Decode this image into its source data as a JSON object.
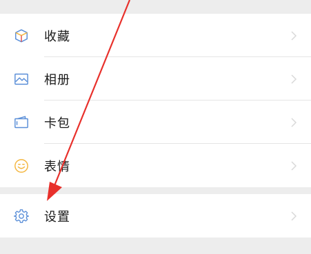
{
  "menu": {
    "items": [
      {
        "label": "收藏",
        "icon": "favorites-cube-icon"
      },
      {
        "label": "相册",
        "icon": "album-picture-icon"
      },
      {
        "label": "卡包",
        "icon": "card-wallet-icon"
      },
      {
        "label": "表情",
        "icon": "smiley-face-icon"
      }
    ],
    "settings": {
      "label": "设置",
      "icon": "settings-gear-icon"
    }
  },
  "colors": {
    "background": "#ededed",
    "row_background": "#ffffff",
    "text": "#191919",
    "icon_blue": "#5b8fd8",
    "icon_yellow": "#f4b63f",
    "icon_red": "#e05050",
    "chevron": "#d9d9d9",
    "annotation_arrow": "#e8302b"
  }
}
